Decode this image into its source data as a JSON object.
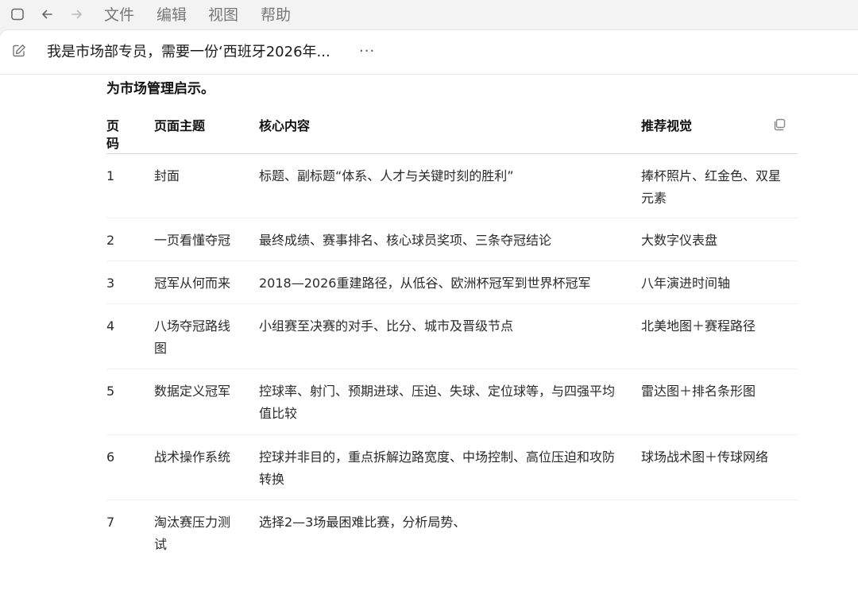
{
  "menubar": {
    "menus": [
      "文件",
      "编辑",
      "视图",
      "帮助"
    ]
  },
  "conversation": {
    "title": "我是市场部专员，需要一份‘西班牙2026年...",
    "more": "···"
  },
  "intro_text": "为市场管理启示。",
  "table": {
    "headers": {
      "no": "页码",
      "topic": "页面主题",
      "core": "核心内容",
      "visual": "推荐视觉"
    },
    "rows": [
      {
        "no": "1",
        "topic": "封面",
        "core": "标题、副标题“体系、人才与关键时刻的胜利”",
        "visual": "捧杯照片、红金色、双星元素"
      },
      {
        "no": "2",
        "topic": "一页看懂夺冠",
        "core": "最终成绩、赛事排名、核心球员奖项、三条夺冠结论",
        "visual": "大数字仪表盘"
      },
      {
        "no": "3",
        "topic": "冠军从何而来",
        "core": "2018—2026重建路径，从低谷、欧洲杯冠军到世界杯冠军",
        "visual": "八年演进时间轴"
      },
      {
        "no": "4",
        "topic": "八场夺冠路线图",
        "core": "小组赛至决赛的对手、比分、城市及晋级节点",
        "visual": "北美地图＋赛程路径"
      },
      {
        "no": "5",
        "topic": "数据定义冠军",
        "core": "控球率、射门、预期进球、压迫、失球、定位球等，与四强平均值比较",
        "visual": "雷达图＋排名条形图"
      },
      {
        "no": "6",
        "topic": "战术操作系统",
        "core": "控球并非目的，重点拆解边路宽度、中场控制、高位压迫和攻防转换",
        "visual": "球场战术图＋传球网络"
      },
      {
        "no": "7",
        "topic": "淘汰赛压力测试",
        "core": "选择2—3场最困难比赛，分析局势、",
        "visual": ""
      }
    ]
  }
}
